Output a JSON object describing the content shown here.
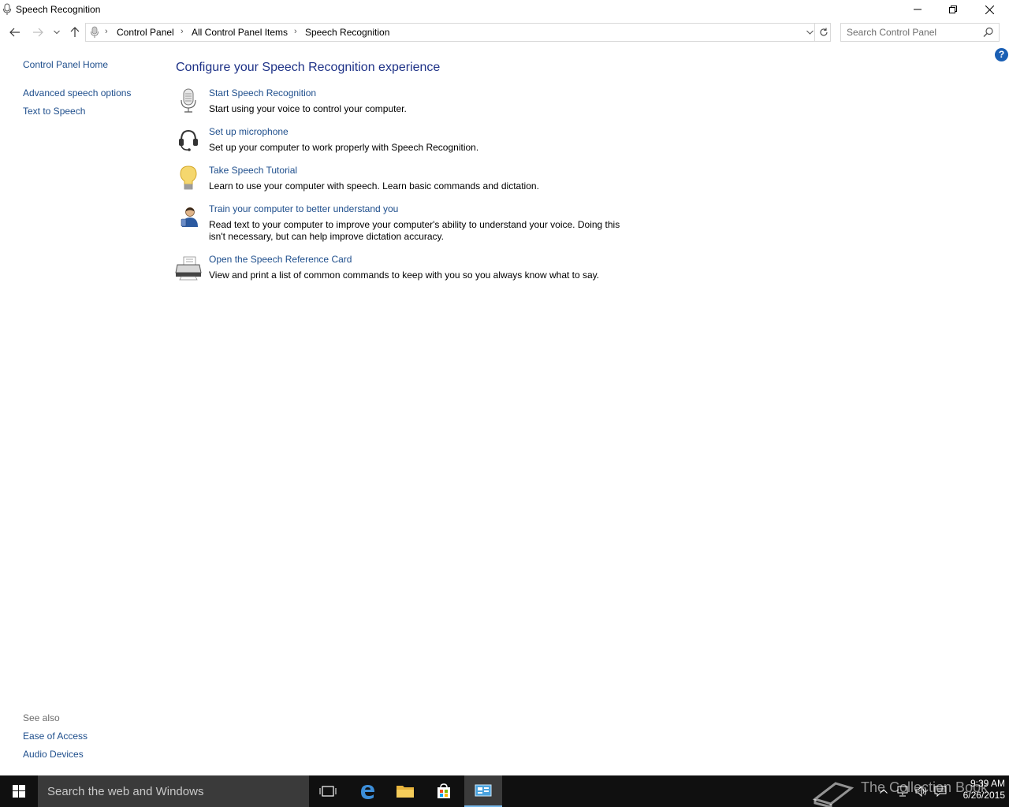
{
  "window": {
    "title": "Speech Recognition"
  },
  "address_bar": {
    "breadcrumbs": [
      "Control Panel",
      "All Control Panel Items",
      "Speech Recognition"
    ]
  },
  "search": {
    "placeholder": "Search Control Panel"
  },
  "sidebar": {
    "home": "Control Panel Home",
    "links": [
      "Advanced speech options",
      "Text to Speech"
    ],
    "see_also_label": "See also",
    "see_also": [
      "Ease of Access",
      "Audio Devices"
    ]
  },
  "help_label": "?",
  "main": {
    "heading": "Configure your Speech Recognition experience",
    "tasks": [
      {
        "icon": "microphone-icon",
        "title": "Start Speech Recognition",
        "description": "Start using your voice to control your computer."
      },
      {
        "icon": "headset-icon",
        "title": "Set up microphone",
        "description": "Set up your computer to work properly with Speech Recognition."
      },
      {
        "icon": "lightbulb-icon",
        "title": "Take Speech Tutorial",
        "description": "Learn to use your computer with speech.  Learn basic commands and dictation."
      },
      {
        "icon": "user-training-icon",
        "title": "Train your computer to better understand you",
        "description": "Read text to your computer to improve your computer's ability to understand your voice.  Doing this isn't necessary, but can help improve dictation accuracy."
      },
      {
        "icon": "printer-icon",
        "title": "Open the Speech Reference Card",
        "description": "View and print a list of common commands to keep with you so you always know what to say."
      }
    ]
  },
  "taskbar": {
    "search_text": "Search the web and Windows",
    "time": "9:39 AM",
    "date": "6/26/2015",
    "watermark": "The Collection Book"
  },
  "colors": {
    "link": "#1e4e8c",
    "heading": "#1e3287",
    "taskbar": "#101010",
    "accent": "#76b9ed"
  }
}
